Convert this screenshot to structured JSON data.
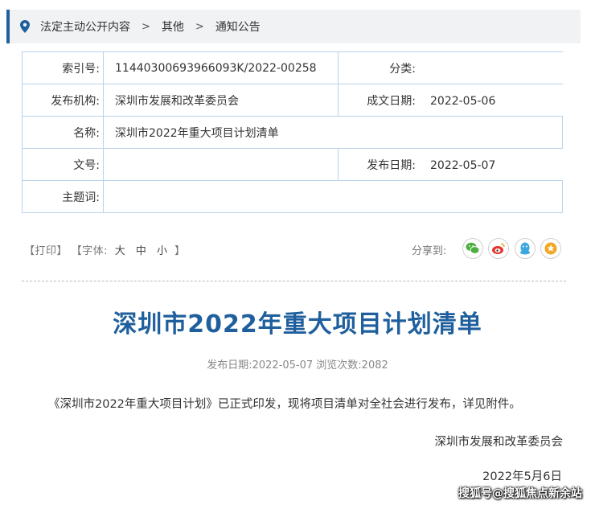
{
  "breadcrumb": {
    "items": [
      "法定主动公开内容",
      "其他",
      "通知公告"
    ],
    "separator": ">"
  },
  "meta": {
    "index_label": "索引号:",
    "index_value": "11440300693966093K/2022-00258",
    "category_label": "分类:",
    "category_value": "",
    "org_label": "发布机构:",
    "org_value": "深圳市发展和改革委员会",
    "written_date_label": "成文日期:",
    "written_date_value": "2022-05-06",
    "name_label": "名称:",
    "name_value": "深圳市2022年重大项目计划清单",
    "doc_no_label": "文号:",
    "doc_no_value": "",
    "pub_date_label": "发布日期:",
    "pub_date_value": "2022-05-07",
    "subject_label": "主题词:",
    "subject_value": ""
  },
  "tools": {
    "print": "【打印】",
    "font_prefix": "【字体:",
    "font_large": "大",
    "font_medium": "中",
    "font_small": "小",
    "font_suffix": "】",
    "share_label": "分享到:",
    "share_icons": [
      "wechat-icon",
      "weibo-icon",
      "qq-icon",
      "favorite-icon"
    ]
  },
  "article": {
    "title": "深圳市2022年重大项目计划清单",
    "pub_info": "发布日期:2022-05-07  浏览次数:2082",
    "body": "《深圳市2022年重大项目计划》已正式印发，现将项目清单对全社会进行发布，详见附件。",
    "signer": "深圳市发展和改革委员会",
    "sign_date": "2022年5月6日"
  },
  "watermark": "搜狐号@搜狐焦点新余站",
  "colors": {
    "accent": "#1f5f9d",
    "table_border": "#b7d3ec",
    "breadcrumb_bg": "#f0f2f4",
    "wechat": "#4caf3f",
    "weibo": "#e6332a",
    "qq": "#3ba7e0",
    "favorite": "#f2a623"
  }
}
